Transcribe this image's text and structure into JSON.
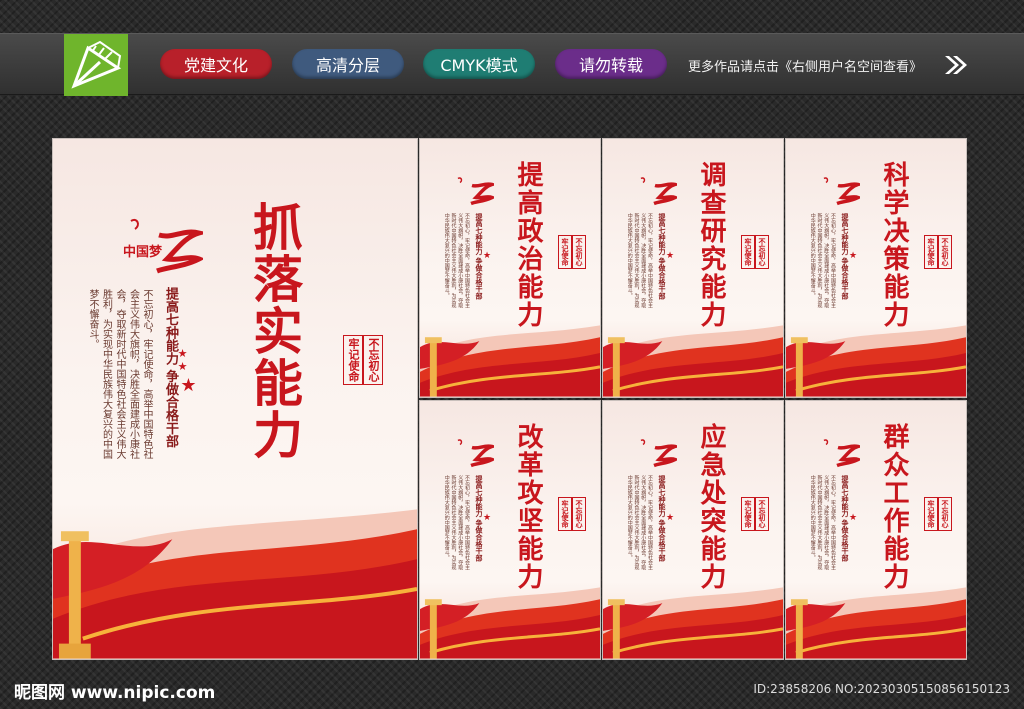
{
  "header": {
    "tags": [
      {
        "label": "党建文化",
        "color": "#b8202a"
      },
      {
        "label": "高清分层",
        "color": "#3f5a7e"
      },
      {
        "label": "CMYK模式",
        "color": "#1f7d73"
      },
      {
        "label": "请勿转载",
        "color": "#6b2d8a"
      }
    ],
    "more_text": "更多作品请点击《右侧用户名空间查看》"
  },
  "main_poster": {
    "title": "抓落实能力",
    "subtitle": "提高七种能力 争做合格干部",
    "slogan": [
      "不忘初心",
      "牢记使命"
    ],
    "body": "不忘初心，牢记使命，高举中国特色社会主义伟大旗帜，决胜全面建成小康社会，夺取新时代中国特色社会主义伟大胜利，为实现中华民族伟大复兴的中国梦不懈奋斗。",
    "logo_text": "中国梦"
  },
  "small_posters": [
    {
      "title": "提高政治能力"
    },
    {
      "title": "调查研究能力"
    },
    {
      "title": "科学决策能力"
    },
    {
      "title": "改革攻坚能力"
    },
    {
      "title": "应急处突能力"
    },
    {
      "title": "群众工作能力"
    }
  ],
  "small_poster_common": {
    "subtitle": "提高七种能力 争做合格干部",
    "slogan": [
      "不忘初心",
      "牢记使命"
    ],
    "body": "不忘初心，牢记使命，高举中国特色社会主义伟大旗帜，决胜全面建成小康社会，夺取新时代中国特色社会主义伟大胜利，为实现中华民族伟大复兴的中国梦不懈奋斗。"
  },
  "footer": {
    "site": "昵图网 www.nipic.com",
    "id_text": "ID:23858206 NO:20230305150856150123"
  },
  "colors": {
    "accent": "#c8161d",
    "logo_green": "#6fb52c"
  }
}
